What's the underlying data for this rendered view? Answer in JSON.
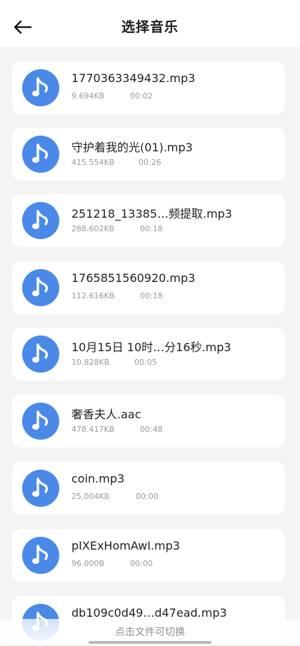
{
  "header": {
    "title": "选择音乐"
  },
  "files": [
    {
      "name": "1770363349432.mp3",
      "size": "9.694KB",
      "duration": "00:02"
    },
    {
      "name": "守护着我的光(01).mp3",
      "size": "415.554KB",
      "duration": "00:26"
    },
    {
      "name": "251218_13385…频提取.mp3",
      "size": "288.602KB",
      "duration": "00:18"
    },
    {
      "name": "1765851560920.mp3",
      "size": "112.616KB",
      "duration": "00:18"
    },
    {
      "name": "10月15日 10时…分16秒.mp3",
      "size": "10.828KB",
      "duration": "00:05"
    },
    {
      "name": "奢香夫人.aac",
      "size": "478.417KB",
      "duration": "00:48"
    },
    {
      "name": "coin.mp3",
      "size": "25.004KB",
      "duration": "00:00"
    },
    {
      "name": "pIXExHomAwI.mp3",
      "size": "96.000B",
      "duration": "00:00"
    },
    {
      "name": "db109c0d49…d47ead.mp3",
      "size": "",
      "duration": ""
    }
  ],
  "footer": {
    "hint": "点击文件可切换"
  },
  "colors": {
    "icon_bg": "#4a89e8",
    "page_bg": "#f4f4f5"
  }
}
